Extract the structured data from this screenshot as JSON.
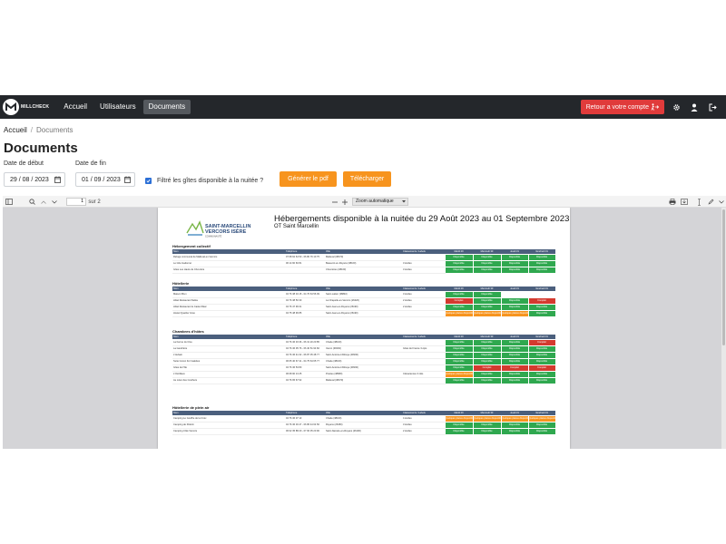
{
  "navbar": {
    "brand": "MILLCHECK",
    "links": [
      "Accueil",
      "Utilisateurs",
      "Documents"
    ],
    "back_button": "Retour a votre compte"
  },
  "breadcrumb": {
    "home": "Accueil",
    "current": "Documents"
  },
  "page_title": "Documents",
  "form": {
    "start_label": "Date de début",
    "start_value": "29 / 08 / 2023",
    "end_label": "Date de fin",
    "end_value": "01 / 09 / 2023",
    "filter_label": "Filtré les gîtes disponible à la nuitée ?",
    "generate_button": "Générer le pdf",
    "download_button": "Télécharger"
  },
  "viewer": {
    "page_number": "1",
    "page_total": "sur 2",
    "zoom": "Zoom automatique"
  },
  "document": {
    "logo_line1": "SAINT-MARCELLIN",
    "logo_line2": "VERCORS ISÈRE",
    "logo_line3": "COMMUNAUTÉ",
    "title": "Hébergements disponible à la nuitée du 29 Août 2023 au 01 Septembre 2023",
    "subtitle": "OT Saint Marcellin",
    "columns": [
      "Nom",
      "Téléphone",
      "Ville",
      "Classements / Labels",
      "Mardi 29",
      "Mercredi 30",
      "Jeudi 31",
      "Vendredi 01"
    ],
    "sections": [
      {
        "title": "Hébergement collectif",
        "rows": [
          {
            "name": "Refuge communal de Malleval-en-Vercors",
            "phone": "07 68 62 64 50 - 06 80 76 10 75",
            "city": "Malleval (38470)",
            "label": "",
            "status": [
              "Disponible",
              "Disponible",
              "Disponible",
              "Disponible"
            ]
          },
          {
            "name": "Le Gîte Gadonné",
            "phone": "06 14 60 60 81",
            "city": "Beauvoir-en-Royans (38160)",
            "label": "3 étoiles",
            "status": [
              "Disponible",
              "Disponible",
              "Disponible",
              "Disponible"
            ]
          },
          {
            "name": "Gîtes Les Hauts de Chevrière",
            "phone": "",
            "city": "Chevrières (38160)",
            "label": "3 étoiles",
            "status": [
              "Disponible",
              "Disponible",
              "Disponible",
              "Disponible"
            ]
          }
        ]
      },
      {
        "title": "Hôtellerie",
        "rows": [
          {
            "name": "Maison Brun",
            "phone": "04 76 38 04 15 - 04 76 64 56 09",
            "city": "Saint-Lattier (38840)",
            "label": "3 étoiles",
            "status": [
              "Disponible",
              "Disponible",
              "",
              ""
            ]
          },
          {
            "name": "Hôtel Restaurant Nelka",
            "phone": "04 76 38 50 30",
            "city": "La Chapelle-en-Vercors (26420)",
            "label": "2 étoiles",
            "status": [
              "Complet",
              "Disponible",
              "Disponible",
              "Complet"
            ]
          },
          {
            "name": "Hôtel Restaurant le Castel Réal",
            "phone": "04 76 47 96 01",
            "city": "Saint-Jean-en-Royans (26190)",
            "label": "2 étoiles",
            "status": [
              "Disponible",
              "Disponible",
              "Disponible",
              "Disponible"
            ]
          },
          {
            "name": "Hostel Quatrier Gras",
            "phone": "04 75 48 96 85",
            "city": "Saint-Jean-en-Royans (26190)",
            "label": "",
            "status": [
              "Quelques places disponibles",
              "Quelques places disponibles",
              "Quelques places disponibles",
              "Disponible"
            ]
          }
        ]
      },
      {
        "title": "Chambres d'hôtes",
        "rows": [
          {
            "name": "La Ferme du Clos",
            "phone": "04 76 36 33 36 - 06 31 20 20 85",
            "city": "Chatte (38160)",
            "label": "",
            "status": [
              "Disponible",
              "Disponible",
              "Disponible",
              "Complet"
            ]
          },
          {
            "name": "La Gandrière",
            "phone": "04 76 36 05 76 - 06 40 51 94 82",
            "city": "Izeron (38160)",
            "label": "Gîtes de France 3 épis",
            "status": [
              "Disponible",
              "Disponible",
              "Disponible",
              "Disponible"
            ]
          },
          {
            "name": "L'Aubain",
            "phone": "04 76 36 41 02 - 06 87 35 48 77",
            "city": "Saint-Antoine-l'Abbaye (38160)",
            "label": "",
            "status": [
              "Disponible",
              "Disponible",
              "Disponible",
              "Disponible"
            ]
          },
          {
            "name": "Suite Cocon For Galettes",
            "phone": "06 05 40 67 41 - 04 75 64 65 77",
            "city": "Chatte (38160)",
            "label": "",
            "status": [
              "Disponible",
              "Disponible",
              "Disponible",
              "Disponible"
            ]
          },
          {
            "name": "Gîtes de l'Ille",
            "phone": "04 76 36 53 80",
            "city": "Saint-Antoine-l'Abbaye (38160)",
            "label": "",
            "status": [
              "Disponible",
              "Complet",
              "Complet",
              "Complet"
            ]
          },
          {
            "name": "L'Ostrillaux",
            "phone": "06 08 90 13 25",
            "city": "Presles (38680)",
            "label": "Clévacances 3 clés",
            "status": [
              "Quelques places disponibles",
              "Disponible",
              "Disponible",
              "Disponible"
            ]
          },
          {
            "name": "Au cœur des Couthers",
            "phone": "04 76 65 67 62",
            "city": "Malleval (38470)",
            "label": "",
            "status": [
              "Disponible",
              "Disponible",
              "Disponible",
              "Disponible"
            ]
          }
        ]
      },
      {
        "title": "Hôtellerie de plein air",
        "rows": [
          {
            "name": "Camping Le Gouffre de la Croix",
            "phone": "04 76 36 07 13",
            "city": "Chatte (38160)",
            "label": "4 étoiles",
            "status": [
              "Quelques places disponibles",
              "Quelques places disponibles",
              "Quelques places disponibles",
              "Quelques places disponibles"
            ]
          },
          {
            "name": "Camping de Pélerin",
            "phone": "04 76 36 03 47 - 06 86 44 64 56",
            "city": "Royans (26450)",
            "label": "3 étoiles",
            "status": [
              "Disponible",
              "Disponible",
              "Disponible",
              "Disponible"
            ]
          },
          {
            "name": "Camping Côté Vercors",
            "phone": "06 02 35 88 20 - 07 66 35 20 90",
            "city": "Saint-Nazaire-en-Royans (26190)",
            "label": "2 étoiles",
            "status": [
              "Disponible",
              "Disponible",
              "Disponible",
              "Disponible"
            ]
          }
        ]
      }
    ]
  },
  "colors": {
    "navbar": "#24272b",
    "danger": "#e03b3b",
    "orange": "#f7941e",
    "available": "#2fa84f",
    "full": "#d43a2f",
    "table_header": "#4b5f7d"
  }
}
